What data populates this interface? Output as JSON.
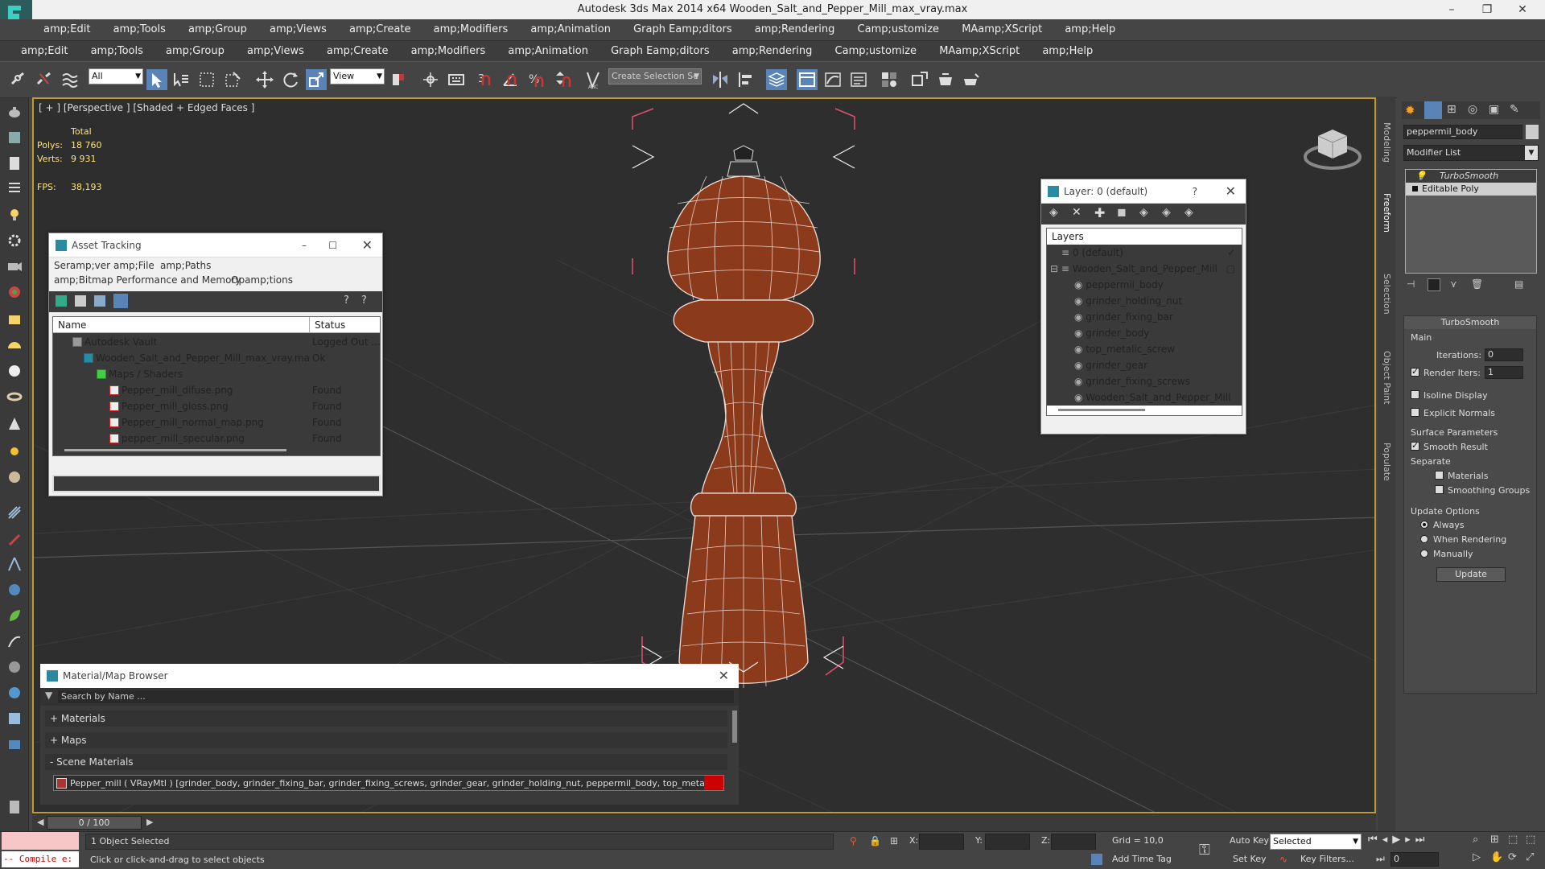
{
  "window": {
    "title": "Autodesk 3ds Max  2014 x64     Wooden_Salt_and_Pepper_Mill_max_vray.max"
  },
  "menu1": [
    "amp;Edit",
    "amp;Tools",
    "amp;Group",
    "amp;Views",
    "amp;Create",
    "amp;Modifiers",
    "amp;Animation",
    "Graph Eamp;ditors",
    "amp;Rendering",
    "Camp;ustomize",
    "MAamp;XScript",
    "amp;Help"
  ],
  "menu2": [
    "amp;Edit",
    "amp;Tools",
    "amp;Group",
    "amp;Views",
    "amp;Create",
    "amp;Modifiers",
    "amp;Animation",
    "Graph Eamp;ditors",
    "amp;Rendering",
    "Camp;ustomize",
    "MAamp;XScript",
    "amp;Help"
  ],
  "toolbar": {
    "filter_value": "All",
    "refcoord_value": "View",
    "selection_set_placeholder": "Create Selection Se"
  },
  "viewport": {
    "label": "[ + ] [Perspective ] [Shaded + Edged Faces ]",
    "stats": {
      "total_label": "Total",
      "polys_label": "Polys:",
      "polys_value": "18 760",
      "verts_label": "Verts:",
      "verts_value": "9 931",
      "fps_label": "FPS:",
      "fps_value": "38,193"
    }
  },
  "asset_tracking": {
    "title": "Asset Tracking",
    "menu_row1": [
      "Seramp;ver",
      "amp;File",
      "amp;Paths"
    ],
    "menu_row2": [
      "amp;Bitmap Performance and Memory",
      "Opamp;tions"
    ],
    "col_name": "Name",
    "col_status": "Status",
    "rows": [
      {
        "name": "Autodesk Vault",
        "status": "Logged Out ..."
      },
      {
        "name": "Wooden_Salt_and_Pepper_Mill_max_vray.max",
        "status": "Ok"
      },
      {
        "name": "Maps / Shaders",
        "status": ""
      },
      {
        "name": "Pepper_mill_difuse.png",
        "status": "Found"
      },
      {
        "name": "Pepper_mill_gloss.png",
        "status": "Found"
      },
      {
        "name": "Pepper_mill_normal_map.png",
        "status": "Found"
      },
      {
        "name": "pepper_mill_specular.png",
        "status": "Found"
      }
    ]
  },
  "layers": {
    "title": "Layer: 0 (default)",
    "help": "?",
    "header": "Layers",
    "items": [
      "0 (default)",
      "Wooden_Salt_and_Pepper_Mill",
      "peppermil_body",
      "grinder_holding_nut",
      "grinder_fixing_bar",
      "grinder_body",
      "top_metalic_screw",
      "grinder_gear",
      "grinder_fixing_screws",
      "Wooden_Salt_and_Pepper_Mill"
    ]
  },
  "material_browser": {
    "title": "Material/Map Browser",
    "search_placeholder": "Search by Name ...",
    "groups": [
      "+ Materials",
      "+ Maps",
      "- Scene Materials"
    ],
    "scene_material": "Pepper_mill ( VRayMtl ) [grinder_body, grinder_fixing_bar, grinder_fixing_screws, grinder_gear, grinder_holding_nut, peppermil_body, top_metalic_screw]"
  },
  "right_panel": {
    "object_name": "peppermil_body",
    "modifier_list": "Modifier List",
    "stack": [
      "TurboSmooth",
      "Editable Poly"
    ],
    "rollout_title": "TurboSmooth",
    "main_label": "Main",
    "iterations_label": "Iterations:",
    "iterations_value": "0",
    "render_iters_label": "Render Iters:",
    "render_iters_value": "1",
    "isoline_label": "Isoline Display",
    "explicit_label": "Explicit Normals",
    "surface_label": "Surface Parameters",
    "smooth_result_label": "Smooth Result",
    "separate_label": "Separate",
    "materials_label": "Materials",
    "smoothing_groups_label": "Smoothing Groups",
    "update_options_label": "Update Options",
    "always_label": "Always",
    "when_rendering_label": "When Rendering",
    "manually_label": "Manually",
    "update_button": "Update",
    "side_tabs": [
      "Modeling",
      "Freeform",
      "Selection",
      "Object Paint",
      "Populate"
    ]
  },
  "timeline": {
    "frame": "0 / 100"
  },
  "statusbar": {
    "script": "-- Compile e:",
    "selected": "1 Object Selected",
    "prompt": "Click or click-and-drag to select objects",
    "x_label": "X:",
    "y_label": "Y:",
    "z_label": "Z:",
    "grid": "Grid = 10,0",
    "add_time_tag": "Add Time Tag",
    "auto_key": "Auto Key",
    "set_key": "Set Key",
    "selected_mode": "Selected",
    "key_filters": "Key Filters...",
    "frame_value": "0"
  },
  "colors": {
    "viewport_border": "#c09a2a",
    "wood": "#8b3a1c",
    "stat_yellow": "#ffe37a",
    "selection_bracket": "#e05070"
  }
}
